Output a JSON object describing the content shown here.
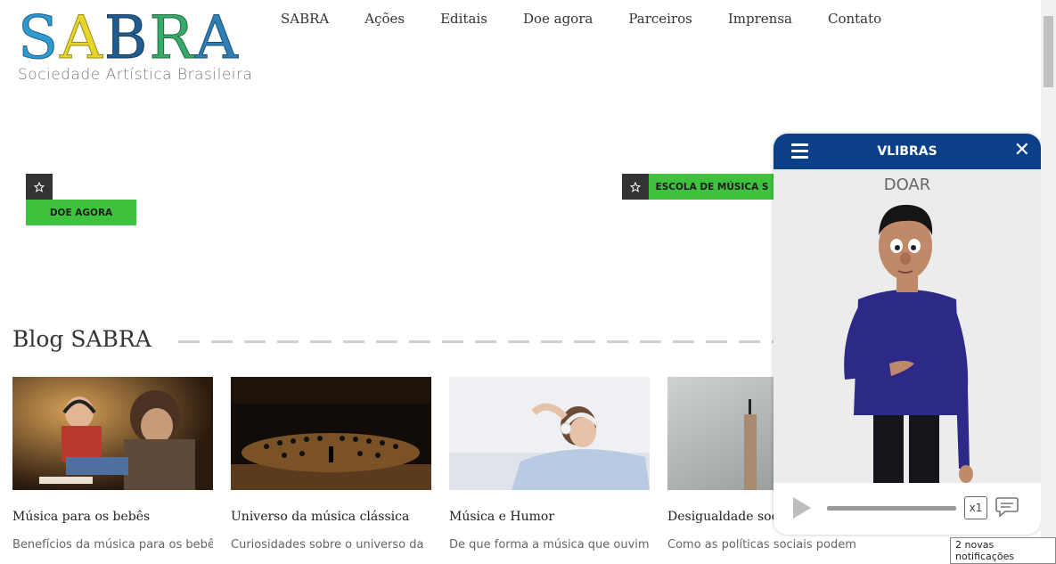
{
  "logo": {
    "letters": [
      "S",
      "A",
      "B",
      "R",
      "A"
    ],
    "subtitle": "Sociedade Artística Brasileira",
    "colors": [
      "#2e9ad0",
      "#e8d52b",
      "#1f5c8f",
      "#37a96b",
      "#2e7fb5"
    ]
  },
  "nav": {
    "items": [
      "SABRA",
      "Ações",
      "Editais",
      "Doe agora",
      "Parceiros",
      "Imprensa",
      "Contato"
    ]
  },
  "buttons": {
    "doe_agora": "DOE AGORA",
    "escola": "ESCOLA DE MÚSICA S"
  },
  "blog": {
    "title": "Blog SABRA",
    "cards": [
      {
        "title": "Música para os bebês",
        "excerpt": "Benefícios da música para os bebês"
      },
      {
        "title": "Universo da música clássica",
        "excerpt": "Curiosidades sobre o universo da"
      },
      {
        "title": "Música e Humor",
        "excerpt": "De que forma a música que ouvimos"
      },
      {
        "title": "Desigualdade soc",
        "excerpt": "Como as políticas sociais podem"
      }
    ]
  },
  "vlibras": {
    "title": "VLIBRAS",
    "word": "DOAR",
    "speed": "x1",
    "header_color": "#0b3f87"
  },
  "notification": "2 novas notificações",
  "colors": {
    "green": "#3ec23e",
    "dark": "#333333"
  }
}
